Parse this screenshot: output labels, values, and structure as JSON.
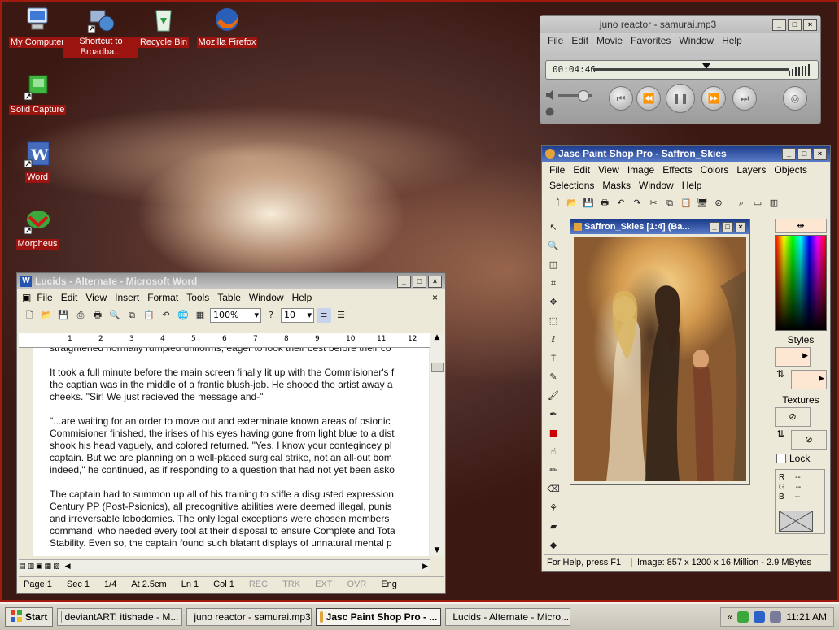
{
  "desktop": {
    "icons": [
      {
        "label": "My Computer",
        "icon": "my-computer-icon"
      },
      {
        "label": "Shortcut to Broadba...",
        "icon": "network-shortcut-icon"
      },
      {
        "label": "Recycle Bin",
        "icon": "recycle-bin-icon"
      },
      {
        "label": "Mozilla Firefox",
        "icon": "firefox-icon"
      },
      {
        "label": "Solid Capture",
        "icon": "solid-capture-icon"
      },
      {
        "label": "Word",
        "icon": "word-icon"
      },
      {
        "label": "Morpheus",
        "icon": "morpheus-icon"
      }
    ]
  },
  "quicktime": {
    "title": "juno reactor - samurai.mp3",
    "menu": [
      "File",
      "Edit",
      "Movie",
      "Favorites",
      "Window",
      "Help"
    ],
    "timecode": "00:04:46",
    "progress": 0.58
  },
  "word": {
    "title": "Lucids - Alternate - Microsoft Word",
    "menu": [
      "File",
      "Edit",
      "View",
      "Insert",
      "Format",
      "Tools",
      "Table",
      "Window",
      "Help"
    ],
    "zoom": "100%",
    "font_size": "10",
    "ruler_marks": [
      "1",
      "2",
      "3",
      "4",
      "5",
      "6",
      "7",
      "8",
      "9",
      "10",
      "11",
      "12"
    ],
    "paragraphs": [
      "straightened normally rumpled uniforms, eager to look their best before their co",
      "It took a full minute before the main screen finally lit up with the Commisioner's f",
      "the captian was in the middle of a frantic blush-job. He shooed the artist away a",
      "cheeks. \"Sir! We just recieved the message and-\"",
      "\"...are waiting for an order to move out and exterminate known areas of psionic",
      "Commisioner finished, the irises of his eyes having gone from light blue to a dist",
      "shook his head vaguely, and colored returned. \"Yes, I know your contegincey pl",
      "captain. But we are planning on a well-placed surgical strike, not an all-out bom",
      "indeed,\" he continued, as if responding to a question that had not yet been asko",
      "The captain had to summon up all of his training to stifle a disgusted expression",
      "Century PP (Post-Psionics), all precognitive abilities were deemed illegal, punis",
      "and irreversable lobodomies. The only legal exceptions were chosen members",
      "command, who needed every tool at their disposal to ensure Complete and Tota",
      "Stability. Even so, the captain found such blatant displays of unnatural mental p"
    ],
    "status": {
      "page": "Page 1",
      "sec": "Sec 1",
      "pages": "1/4",
      "at": "At 2.5cm",
      "ln": "Ln 1",
      "col": "Col 1",
      "rec": "REC",
      "trk": "TRK",
      "ext": "EXT",
      "ovr": "OVR",
      "lang": "Eng"
    }
  },
  "psp": {
    "title": "Jasc Paint Shop Pro - Saffron_Skies",
    "menu1": [
      "File",
      "Edit",
      "View",
      "Image",
      "Effects",
      "Colors",
      "Layers",
      "Objects"
    ],
    "menu2": [
      "Selections",
      "Masks",
      "Window",
      "Help"
    ],
    "doc_title": "Saffron_Skies [1:4] (Ba...",
    "styles_label": "Styles",
    "textures_label": "Textures",
    "lock_label": "Lock",
    "rgb": {
      "r": "R",
      "g": "G",
      "b": "B",
      "r_val": "--",
      "g_val": "--",
      "b_val": "--"
    },
    "status_help": "For Help, press F1",
    "status_image": "Image:  857 x 1200 x 16 Million - 2.9 MBytes"
  },
  "taskbar": {
    "start": "Start",
    "tasks": [
      {
        "label": "deviantART: itishade - M...",
        "icon": "firefox-icon",
        "active": false
      },
      {
        "label": "juno reactor - samurai.mp3",
        "icon": "quicktime-icon",
        "active": false
      },
      {
        "label": "Jasc Paint Shop Pro - ...",
        "icon": "psp-icon",
        "active": true
      },
      {
        "label": "Lucids - Alternate - Micro...",
        "icon": "word-icon",
        "active": false
      }
    ],
    "clock": "11:21 AM"
  },
  "colors": {
    "desktop_border": "#a11a10",
    "label_bg": "#9b1410",
    "title_active": "#1c3c8c"
  }
}
